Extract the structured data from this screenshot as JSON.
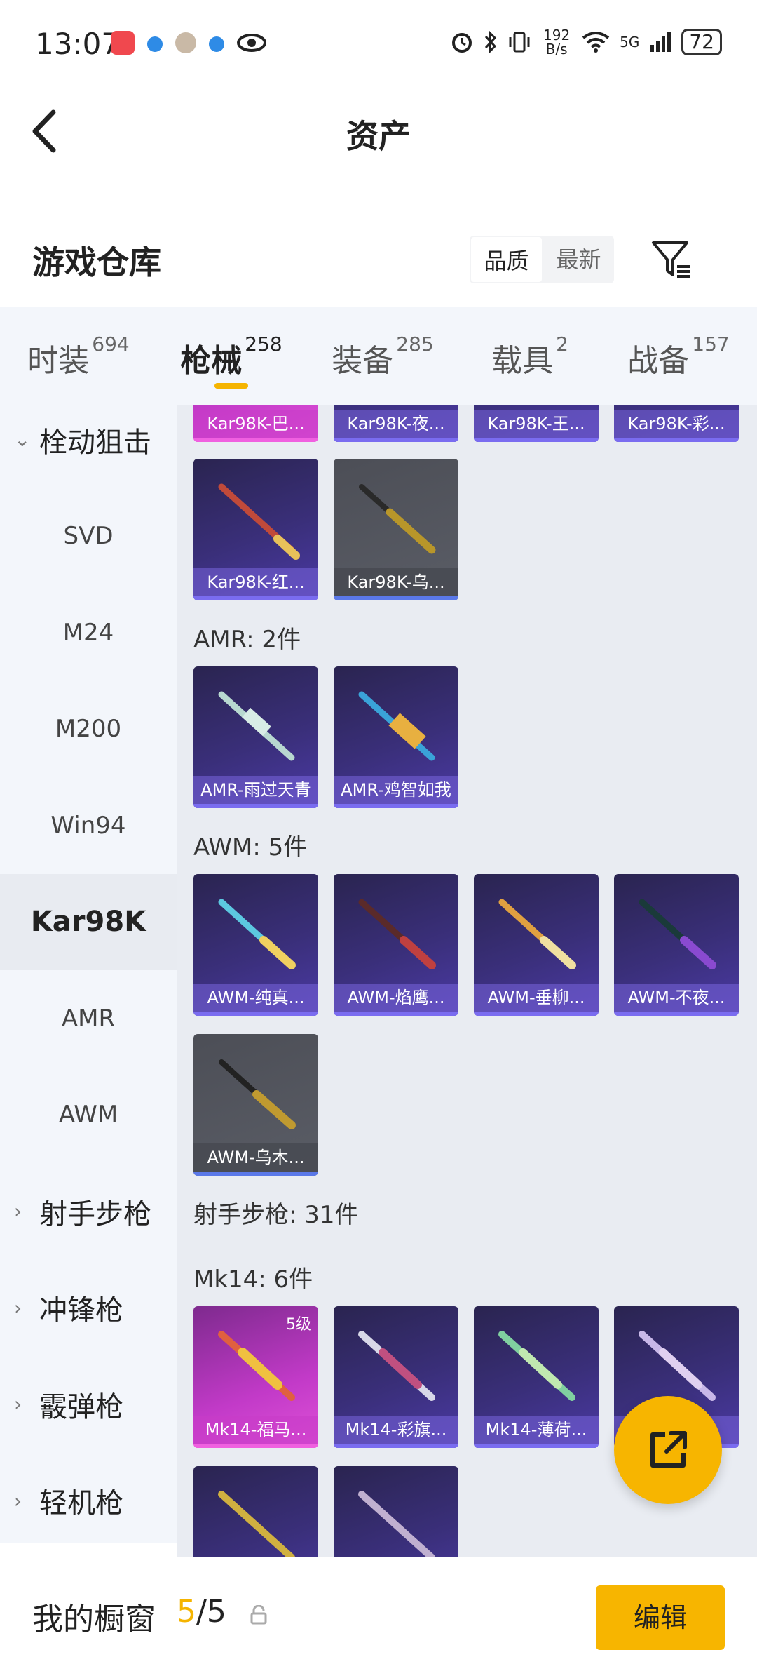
{
  "status_bar": {
    "time": "13:07",
    "network_speed": "192 B/s",
    "network_type": "5G",
    "battery": "72"
  },
  "header": {
    "title": "资产"
  },
  "warehouse": {
    "title": "游戏仓库",
    "sort_options": [
      "品质",
      "最新"
    ],
    "active_sort": "品质"
  },
  "tabs": [
    {
      "label": "时装",
      "count": "694"
    },
    {
      "label": "枪械",
      "count": "258"
    },
    {
      "label": "装备",
      "count": "285"
    },
    {
      "label": "载具",
      "count": "2"
    },
    {
      "label": "战备",
      "count": "157"
    }
  ],
  "sidebar": {
    "items": [
      {
        "label": "栓动狙击",
        "type": "group",
        "chevron": "⌄"
      },
      {
        "label": "SVD",
        "type": "sub"
      },
      {
        "label": "M24",
        "type": "sub"
      },
      {
        "label": "M200",
        "type": "sub"
      },
      {
        "label": "Win94",
        "type": "sub"
      },
      {
        "label": "Kar98K",
        "type": "sub",
        "active": true
      },
      {
        "label": "AMR",
        "type": "sub"
      },
      {
        "label": "AWM",
        "type": "sub"
      },
      {
        "label": "射手步枪",
        "type": "group",
        "chevron": "›"
      },
      {
        "label": "冲锋枪",
        "type": "group",
        "chevron": "›"
      },
      {
        "label": "霰弹枪",
        "type": "group",
        "chevron": "›"
      },
      {
        "label": "轻机枪",
        "type": "group",
        "chevron": "›"
      }
    ]
  },
  "content": {
    "kar98k_top_row": [
      "Kar98K-巴...",
      "Kar98K-夜...",
      "Kar98K-王...",
      "Kar98K-彩..."
    ],
    "kar98k_row2": [
      {
        "name": "Kar98K-红...",
        "style": "purple"
      },
      {
        "name": "Kar98K-乌...",
        "style": "grey"
      }
    ],
    "amr_label": "AMR: 2件",
    "amr_items": [
      {
        "name": "AMR-雨过天青",
        "style": "purple"
      },
      {
        "name": "AMR-鸡智如我",
        "style": "purple"
      }
    ],
    "awm_label": "AWM: 5件",
    "awm_items": [
      {
        "name": "AWM-纯真...",
        "style": "purple"
      },
      {
        "name": "AWM-焰鹰...",
        "style": "purple"
      },
      {
        "name": "AWM-垂柳...",
        "style": "purple"
      },
      {
        "name": "AWM-不夜...",
        "style": "purple"
      },
      {
        "name": "AWM-乌木...",
        "style": "grey"
      }
    ],
    "dmr_label": "射手步枪: 31件",
    "mk14_label": "Mk14: 6件",
    "mk14_items": [
      {
        "name": "Mk14-福马...",
        "style": "pink",
        "level": "5级"
      },
      {
        "name": "Mk14-彩旗...",
        "style": "purple"
      },
      {
        "name": "Mk14-薄荷...",
        "style": "purple"
      },
      {
        "name": "...",
        "style": "purple"
      }
    ]
  },
  "bottom_bar": {
    "label": "我的橱窗",
    "current": "5",
    "separator_total": "/5",
    "edit_label": "编辑"
  },
  "colors": {
    "accent": "#f7b500",
    "purple_card": "#3a2f7a",
    "grey_card": "#5a5d66",
    "pink_card": "#c23ac8"
  }
}
